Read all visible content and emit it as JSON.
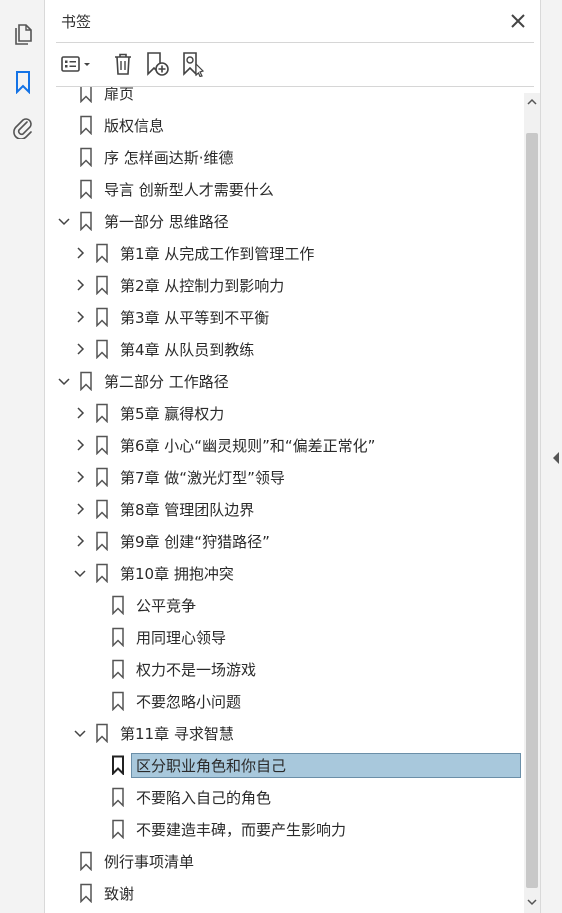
{
  "rail": {
    "items": [
      {
        "name": "pages-icon"
      },
      {
        "name": "bookmark-icon"
      },
      {
        "name": "attachment-icon"
      }
    ]
  },
  "panel": {
    "title": "书签",
    "toolbar": [
      "options-dropdown-icon",
      "delete-icon",
      "add-bookmark-icon",
      "find-bookmark-icon"
    ]
  },
  "bookmarks": [
    {
      "label": "扉页",
      "level": 0,
      "expand": "none",
      "partial": true
    },
    {
      "label": "版权信息",
      "level": 0,
      "expand": "none"
    },
    {
      "label": "序 怎样画达斯·维德",
      "level": 0,
      "expand": "none"
    },
    {
      "label": "导言 创新型人才需要什么",
      "level": 0,
      "expand": "none"
    },
    {
      "label": "第一部分 思维路径",
      "level": 0,
      "expand": "open"
    },
    {
      "label": "第1章 从完成工作到管理工作",
      "level": 1,
      "expand": "closed"
    },
    {
      "label": "第2章 从控制力到影响力",
      "level": 1,
      "expand": "closed"
    },
    {
      "label": "第3章 从平等到不平衡",
      "level": 1,
      "expand": "closed"
    },
    {
      "label": "第4章 从队员到教练",
      "level": 1,
      "expand": "closed"
    },
    {
      "label": "第二部分 工作路径",
      "level": 0,
      "expand": "open"
    },
    {
      "label": "第5章 赢得权力",
      "level": 1,
      "expand": "closed"
    },
    {
      "label": "第6章 小心“幽灵规则”和“偏差正常化”",
      "level": 1,
      "expand": "closed"
    },
    {
      "label": "第7章 做“激光灯型”领导",
      "level": 1,
      "expand": "closed"
    },
    {
      "label": "第8章 管理团队边界",
      "level": 1,
      "expand": "closed"
    },
    {
      "label": "第9章 创建“狩猎路径”",
      "level": 1,
      "expand": "closed"
    },
    {
      "label": "第10章 拥抱冲突",
      "level": 1,
      "expand": "open"
    },
    {
      "label": "公平竞争",
      "level": 2,
      "expand": "none"
    },
    {
      "label": "用同理心领导",
      "level": 2,
      "expand": "none"
    },
    {
      "label": "权力不是一场游戏",
      "level": 2,
      "expand": "none"
    },
    {
      "label": "不要忽略小问题",
      "level": 2,
      "expand": "none"
    },
    {
      "label": "第11章 寻求智慧",
      "level": 1,
      "expand": "open"
    },
    {
      "label": "区分职业角色和你自己",
      "level": 2,
      "expand": "none",
      "selected": true
    },
    {
      "label": "不要陷入自己的角色",
      "level": 2,
      "expand": "none"
    },
    {
      "label": "不要建造丰碑，而要产生影响力",
      "level": 2,
      "expand": "none"
    },
    {
      "label": "例行事项清单",
      "level": 0,
      "expand": "none"
    },
    {
      "label": "致谢",
      "level": 0,
      "expand": "none"
    }
  ],
  "colors": {
    "selected_bg": "#a8c8dc",
    "accent": "#1473e6"
  }
}
